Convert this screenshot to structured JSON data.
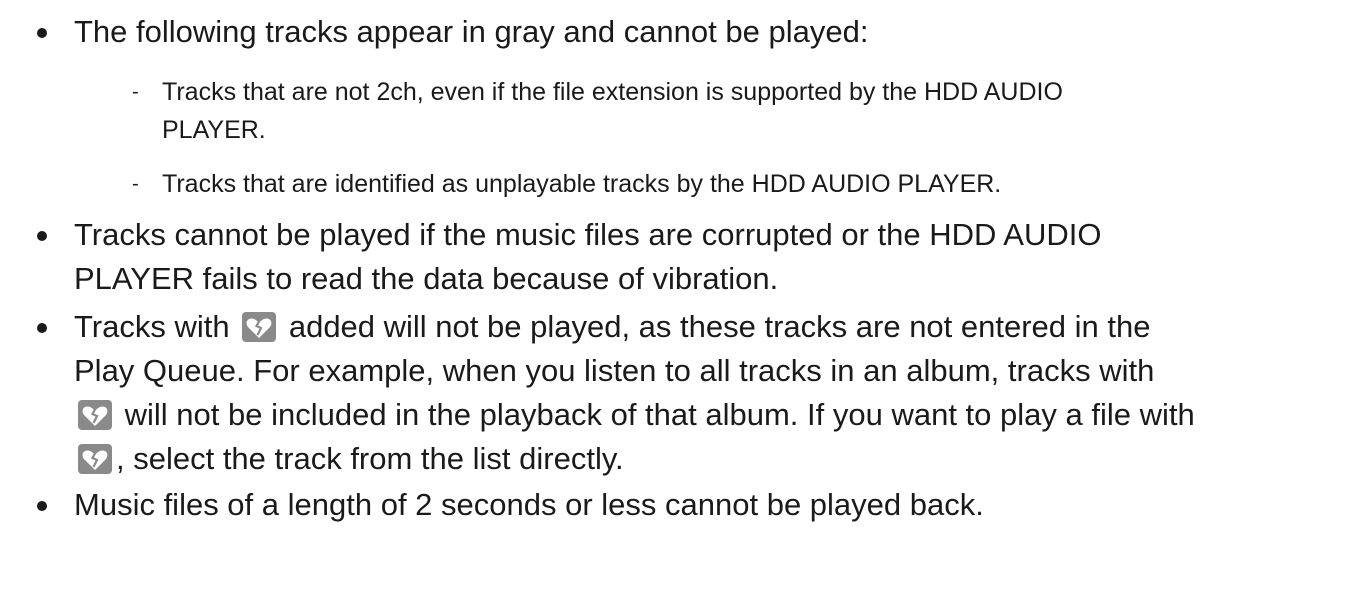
{
  "items": [
    {
      "text": "The following tracks appear in gray and cannot be played:",
      "subitems": [
        {
          "line1": "Tracks that are not 2ch, even if the file extension is supported by the HDD AUDIO",
          "line2": "PLAYER."
        },
        {
          "line1": "Tracks that are identified as unplayable tracks by the HDD AUDIO PLAYER."
        }
      ]
    },
    {
      "line1": "Tracks cannot be played if the music files are corrupted or the HDD AUDIO",
      "line2": "PLAYER fails to read the data because of vibration."
    },
    {
      "p1": "Tracks with",
      "p2": " added will not be played, as these tracks are not entered in the",
      "line2": "Play Queue. For example, when you listen to all tracks in an album, tracks with",
      "p3": " will not be included in the playback of that album. If you want to play a file with",
      "p4": ", select the track from the list directly."
    },
    {
      "text": "Music files of a length of 2 seconds or less cannot be played back."
    }
  ],
  "sub_marker": "-",
  "icon": {
    "name": "broken-heart-icon",
    "background": "#8a8a8a",
    "foreground": "#ffffff"
  }
}
